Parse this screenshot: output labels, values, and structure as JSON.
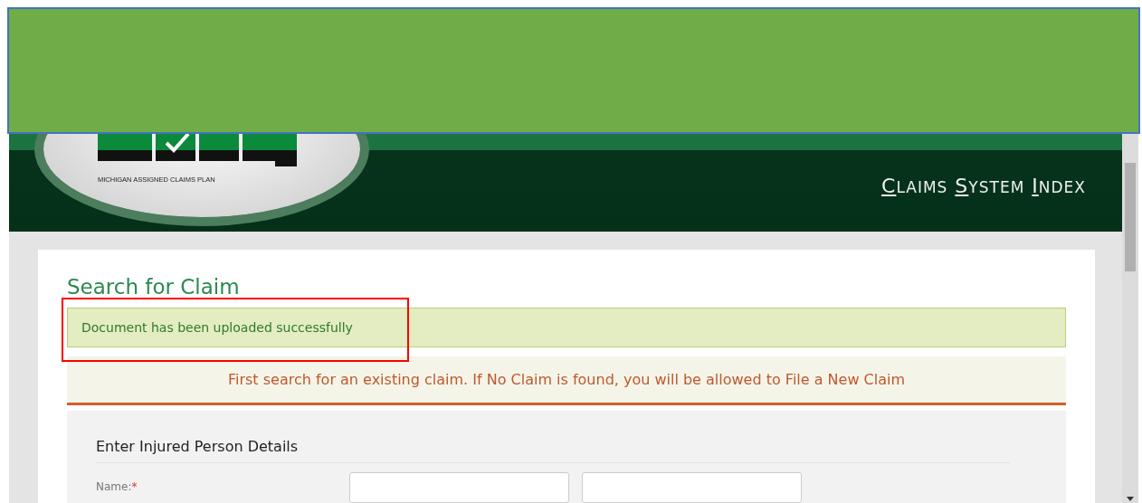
{
  "logo": {
    "tagline": "MICHIGAN ASSIGNED CLAIMS PLAN"
  },
  "nav": {
    "words": [
      "CLAIMS",
      "SYSTEM",
      "INDEX"
    ]
  },
  "page": {
    "title": "Search for Claim",
    "alert": {
      "text": "Document has been uploaded successfully",
      "highlighted": true
    },
    "notice": "First search for an existing claim. If No Claim is found, you will be allowed to File a New Claim",
    "section": {
      "title": "Enter Injured Person Details",
      "fields": [
        {
          "label": "Name:",
          "required_mark": "*",
          "inputs": [
            {
              "kind": "text"
            },
            {
              "kind": "text"
            }
          ]
        }
      ]
    }
  }
}
